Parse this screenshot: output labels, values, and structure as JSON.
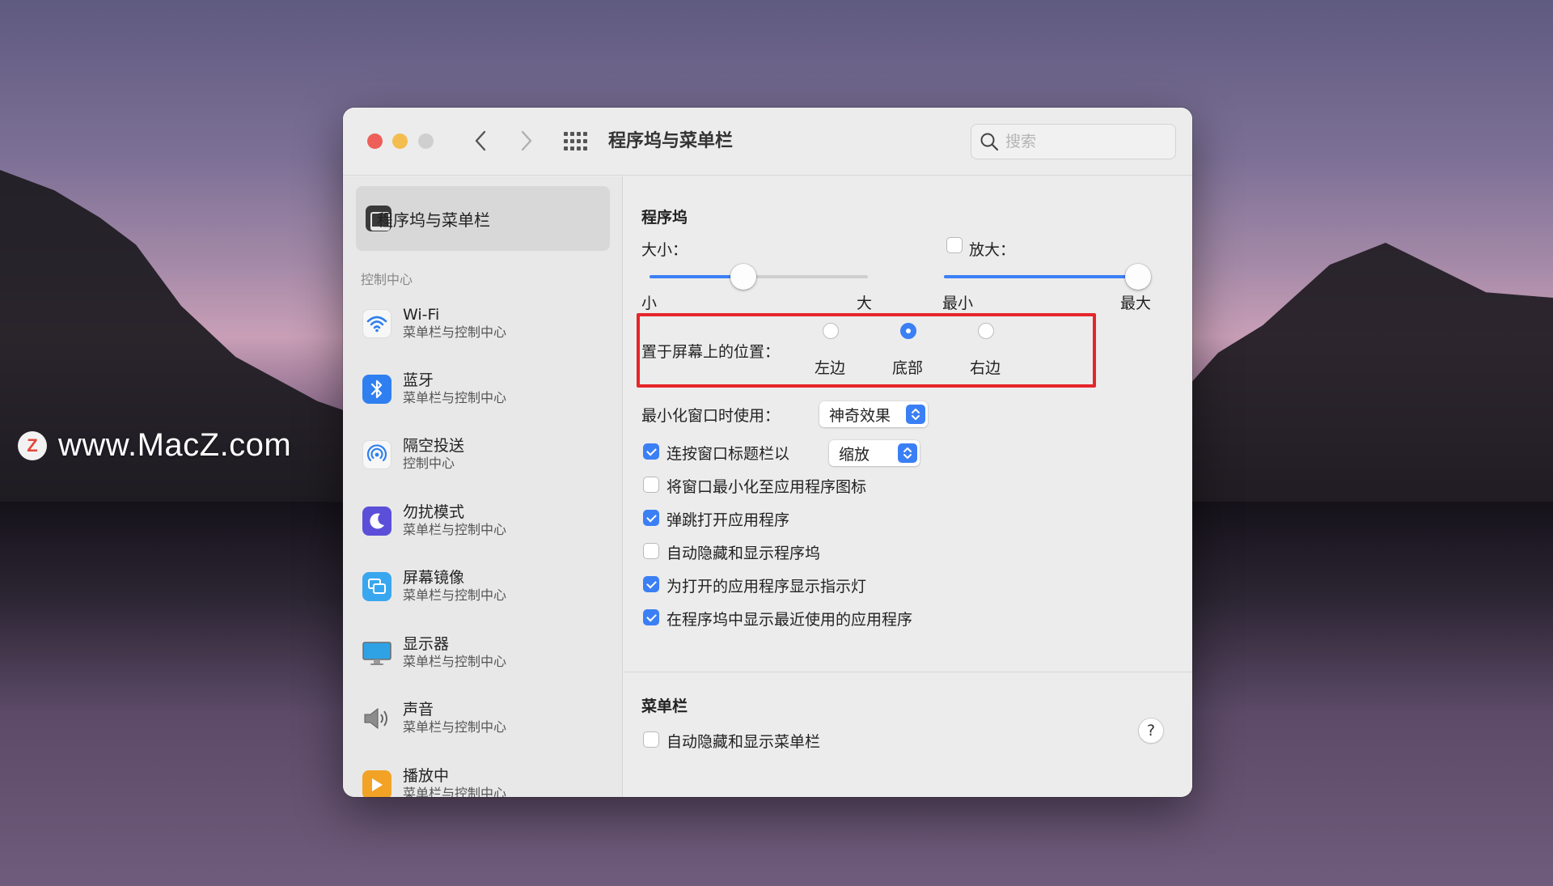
{
  "watermark": {
    "logo_letter": "Z",
    "text": "www.MacZ.com"
  },
  "window": {
    "title": "程序坞与菜单栏",
    "search": {
      "placeholder": "搜索",
      "value": ""
    }
  },
  "sidebar": {
    "active": {
      "label": "程序坞与菜单栏",
      "icon": "dock-icon"
    },
    "section_label": "控制中心",
    "items": [
      {
        "name": "Wi-Fi",
        "sub": "菜单栏与控制中心",
        "icon": "wifi-icon"
      },
      {
        "name": "蓝牙",
        "sub": "菜单栏与控制中心",
        "icon": "bluetooth-icon"
      },
      {
        "name": "隔空投送",
        "sub": "控制中心",
        "icon": "airdrop-icon"
      },
      {
        "name": "勿扰模式",
        "sub": "菜单栏与控制中心",
        "icon": "moon-icon"
      },
      {
        "name": "屏幕镜像",
        "sub": "菜单栏与控制中心",
        "icon": "screen-mirror-icon"
      },
      {
        "name": "显示器",
        "sub": "菜单栏与控制中心",
        "icon": "display-icon"
      },
      {
        "name": "声音",
        "sub": "菜单栏与控制中心",
        "icon": "speaker-icon"
      },
      {
        "name": "播放中",
        "sub": "菜单栏与控制中心",
        "icon": "play-icon"
      }
    ]
  },
  "dock": {
    "section_title": "程序坞",
    "size": {
      "label": "大小：",
      "min_label": "小",
      "max_label": "大",
      "value": 0.43
    },
    "magnification": {
      "label": "放大：",
      "checked": false,
      "min_label": "最小",
      "max_label": "最大",
      "value": 1.0
    },
    "position": {
      "label": "置于屏幕上的位置：",
      "options": [
        "左边",
        "底部",
        "右边"
      ],
      "selected": "底部"
    },
    "minimize_effect": {
      "label": "最小化窗口时使用：",
      "value": "神奇效果"
    },
    "double_click": {
      "label": "连按窗口标题栏以",
      "checked": true,
      "value": "缩放"
    },
    "options": [
      {
        "label": "将窗口最小化至应用程序图标",
        "checked": false
      },
      {
        "label": "弹跳打开应用程序",
        "checked": true
      },
      {
        "label": "自动隐藏和显示程序坞",
        "checked": false
      },
      {
        "label": "为打开的应用程序显示指示灯",
        "checked": true
      },
      {
        "label": "在程序坞中显示最近使用的应用程序",
        "checked": true
      }
    ]
  },
  "menubar": {
    "section_title": "菜单栏",
    "auto_hide": {
      "label": "自动隐藏和显示菜单栏",
      "checked": false
    },
    "help": "?"
  },
  "colors": {
    "accent": "#3b7ff5",
    "highlight_box": "#e5262b"
  }
}
